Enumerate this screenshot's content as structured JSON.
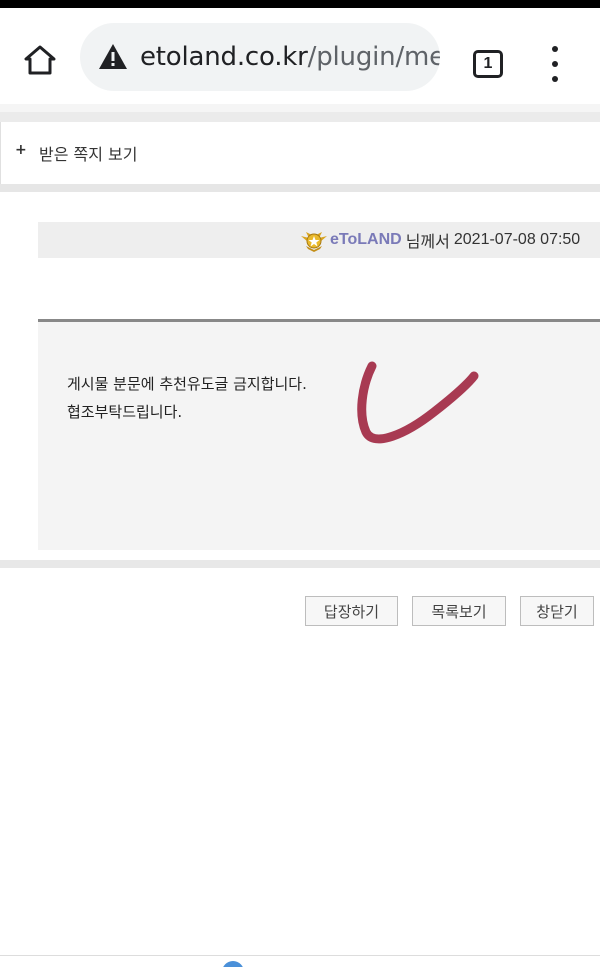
{
  "browser": {
    "url_host": "etoland.co.kr",
    "url_path": "/plugin/me",
    "tab_count": "1",
    "icons": {
      "home": "home-icon",
      "security": "warning-icon",
      "tabs": "tab-switcher-icon",
      "menu": "more-vert-icon"
    }
  },
  "page": {
    "title": "받은 쪽지 보기",
    "expand_icon": "+"
  },
  "message": {
    "sender": "eToLAND",
    "sender_suffix": "님께서",
    "sent_at": "2021-07-08 07:50",
    "body_line1": "게시물 분문에 추천유도글 금지합니다.",
    "body_line2": "협조부탁드립니다.",
    "annotation_color": "#a83a52"
  },
  "actions": {
    "reply": "답장하기",
    "list": "목록보기",
    "close": "창닫기"
  }
}
